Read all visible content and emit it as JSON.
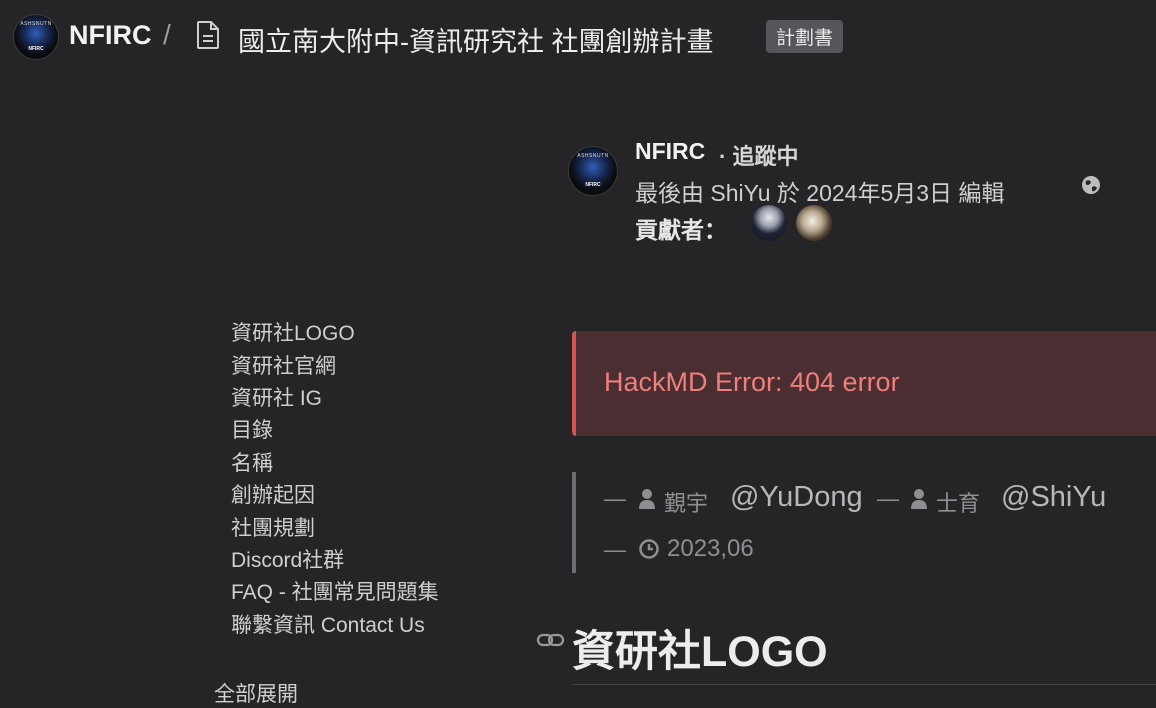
{
  "header": {
    "team_logo_top": "ASHSNUTN",
    "team_logo_bottom": "NFIRC",
    "team_name": "NFIRC",
    "separator": "/",
    "note_title": "國立南大附中-資訊研究社 社團創辦計畫",
    "tag": "計劃書"
  },
  "owner": {
    "name": "NFIRC",
    "follow_status": "· 追蹤中",
    "edit_info": "最後由 ShiYu 於 2024年5月3日 編輯",
    "contributors_label": "貢獻者："
  },
  "toc": {
    "items": [
      "資研社LOGO",
      "資研社官網",
      "資研社 IG",
      "目錄",
      "名稱",
      "創辦起因",
      "社團規劃",
      "Discord社群",
      "FAQ - 社團常見問題集",
      "聯繫資訊 Contact Us"
    ],
    "expand_all": "全部展開"
  },
  "content": {
    "error_message": "HackMD Error: 404 error",
    "quote": {
      "dash1": "—",
      "author1_name": "覲宇",
      "author1_handle": "@YuDong",
      "dash2": "—",
      "author2_name": "士育",
      "author2_handle": "@ShiYu",
      "dash3": "—",
      "date": "2023,06"
    },
    "heading": "資研社LOGO"
  },
  "colors": {
    "background": "#252527",
    "error_bg": "#4b2e31",
    "error_border": "#d9534f",
    "error_text": "#ef7f7b"
  }
}
